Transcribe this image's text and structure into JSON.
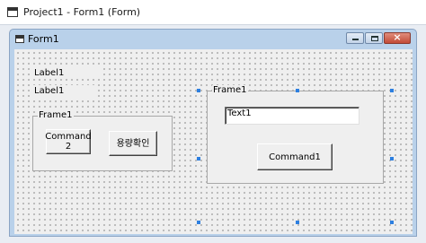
{
  "window": {
    "title": "Project1 - Form1 (Form)"
  },
  "form": {
    "title": "Form1",
    "close_glyph": "×"
  },
  "controls": {
    "label1_top": "Label1",
    "label1_bottom": "Label1",
    "frame_left": {
      "caption": "Frame1",
      "button1": "Command\n2",
      "button2": "용량확인"
    },
    "frame_right": {
      "caption": "Frame1",
      "textbox": "Text1",
      "button": "Command1"
    }
  },
  "colors": {
    "selection_handle": "#2d7fe0",
    "form_border": "#b9d1ea",
    "close_button": "#c24a36"
  },
  "icons": [
    "window-icon",
    "minimize-icon",
    "maximize-icon",
    "close-icon"
  ]
}
